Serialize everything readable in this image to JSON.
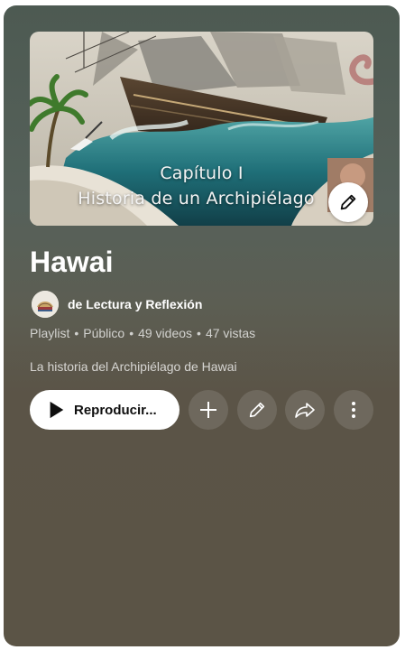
{
  "playlist": {
    "title": "Hawai",
    "channel_name": "de Lectura y Reflexión",
    "type": "Playlist",
    "visibility": "Público",
    "video_count": "49 videos",
    "views": "47 vistas",
    "separator": "•",
    "description": "La historia del Archipiélago de Hawai"
  },
  "thumbnail": {
    "caption_line1": "Capítulo I",
    "caption_line2": "Historia de un Archipiélago"
  },
  "actions": {
    "play_label": "Reproducir..."
  },
  "icons": {
    "thumb_edit": "pencil-icon",
    "play": "play-icon",
    "add": "plus-icon",
    "edit": "pencil-icon",
    "share": "share-arrow-icon",
    "more": "more-vertical-icon"
  },
  "colors": {
    "card_top": "#4d5a52",
    "card_bottom": "#5b5446",
    "button_bg": "#ffffff",
    "icon_button_bg": "rgba(255,255,255,0.12)"
  }
}
